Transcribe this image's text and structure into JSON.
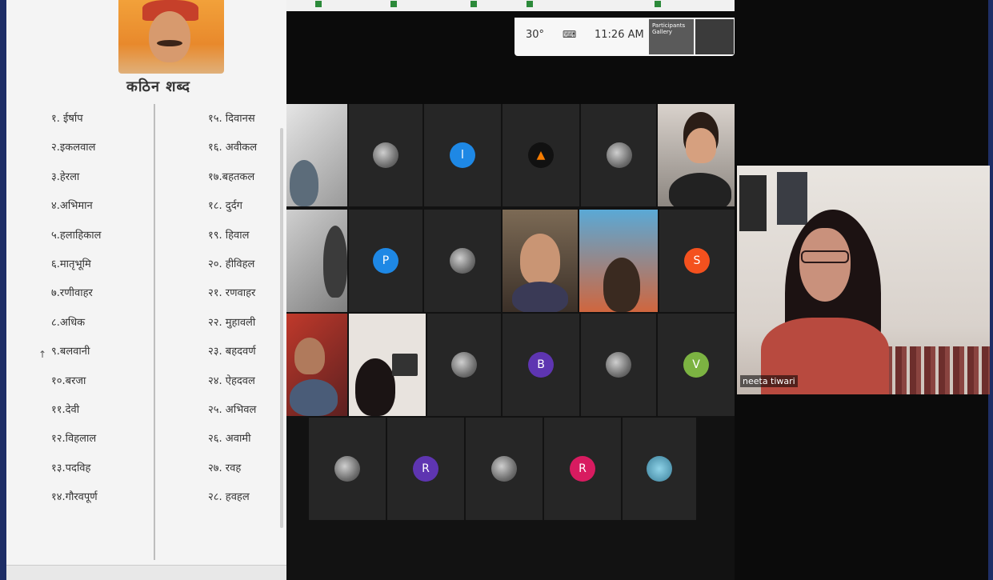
{
  "document": {
    "title": "कठिन शब्द",
    "words_left": [
      "१. ईर्षाप",
      "२.इकलवाल",
      "३.हेरला",
      "४.अभिमान",
      "५.हलाहिकाल",
      "६.मातृभूमि",
      "७.रणीवाहर",
      "८.अधिक",
      "९.बलवानी",
      "१०.बरजा",
      "११.देवी",
      "१२.विहलाल",
      "१३.पदविह",
      "१४.गौरवपूर्ण"
    ],
    "words_right": [
      "१५. दिवानस",
      "१६. अवीकल",
      "१७.बहतकल",
      "१८. दुर्दग",
      "१९. हिवाल",
      "२०. हीविहल",
      "२१. रणवाहर",
      "२२. मुहावली",
      "२३. बहदवर्ण",
      "२४. ऐहदवल",
      "२५. अभिवल",
      "२६. अवामी",
      "२७. रवह",
      "२८. हवहल"
    ]
  },
  "system_tray": {
    "temperature": "30°",
    "time": "11:26 AM",
    "window_label": "Participants Gallery"
  },
  "participant_initials": [
    "l",
    "P",
    "S",
    "B",
    "V",
    "R",
    "R"
  ],
  "teacher": {
    "name": "neeta tiwari"
  },
  "colors": {
    "blue_avatar": "#1e88e5",
    "orange_avatar": "#f4511e",
    "purple_avatar": "#5e35b1",
    "green_avatar": "#7cb342",
    "pink_avatar": "#d81b60",
    "border": "#1e2e66"
  }
}
